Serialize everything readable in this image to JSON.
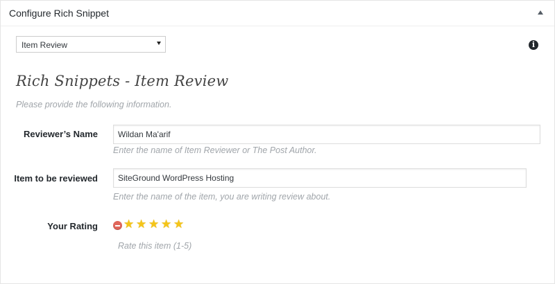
{
  "panel": {
    "title": "Configure Rich Snippet"
  },
  "snippet_type": {
    "selected": "Item Review"
  },
  "heading": "Rich Snippets - Item Review",
  "subheading": "Please provide the following information.",
  "fields": {
    "reviewer_name": {
      "label": "Reviewer’s Name",
      "value": "Wildan Ma'arif",
      "hint": "Enter the name of Item Reviewer or The Post Author."
    },
    "item_reviewed": {
      "label": "Item to be reviewed",
      "value": "SiteGround WordPress Hosting",
      "hint": "Enter the name of the item, you are writing review about."
    },
    "rating": {
      "label": "Your Rating",
      "stars": 5,
      "max": 5,
      "hint": "Rate this item (1-5)"
    }
  },
  "icons": {
    "collapse": "triangle-up-icon",
    "info": "info-icon",
    "cancel": "minus-circle-icon",
    "star": "star-icon"
  },
  "colors": {
    "star": "#f5c518",
    "cancel": "#e0665a",
    "hint": "#a0a5aa"
  }
}
